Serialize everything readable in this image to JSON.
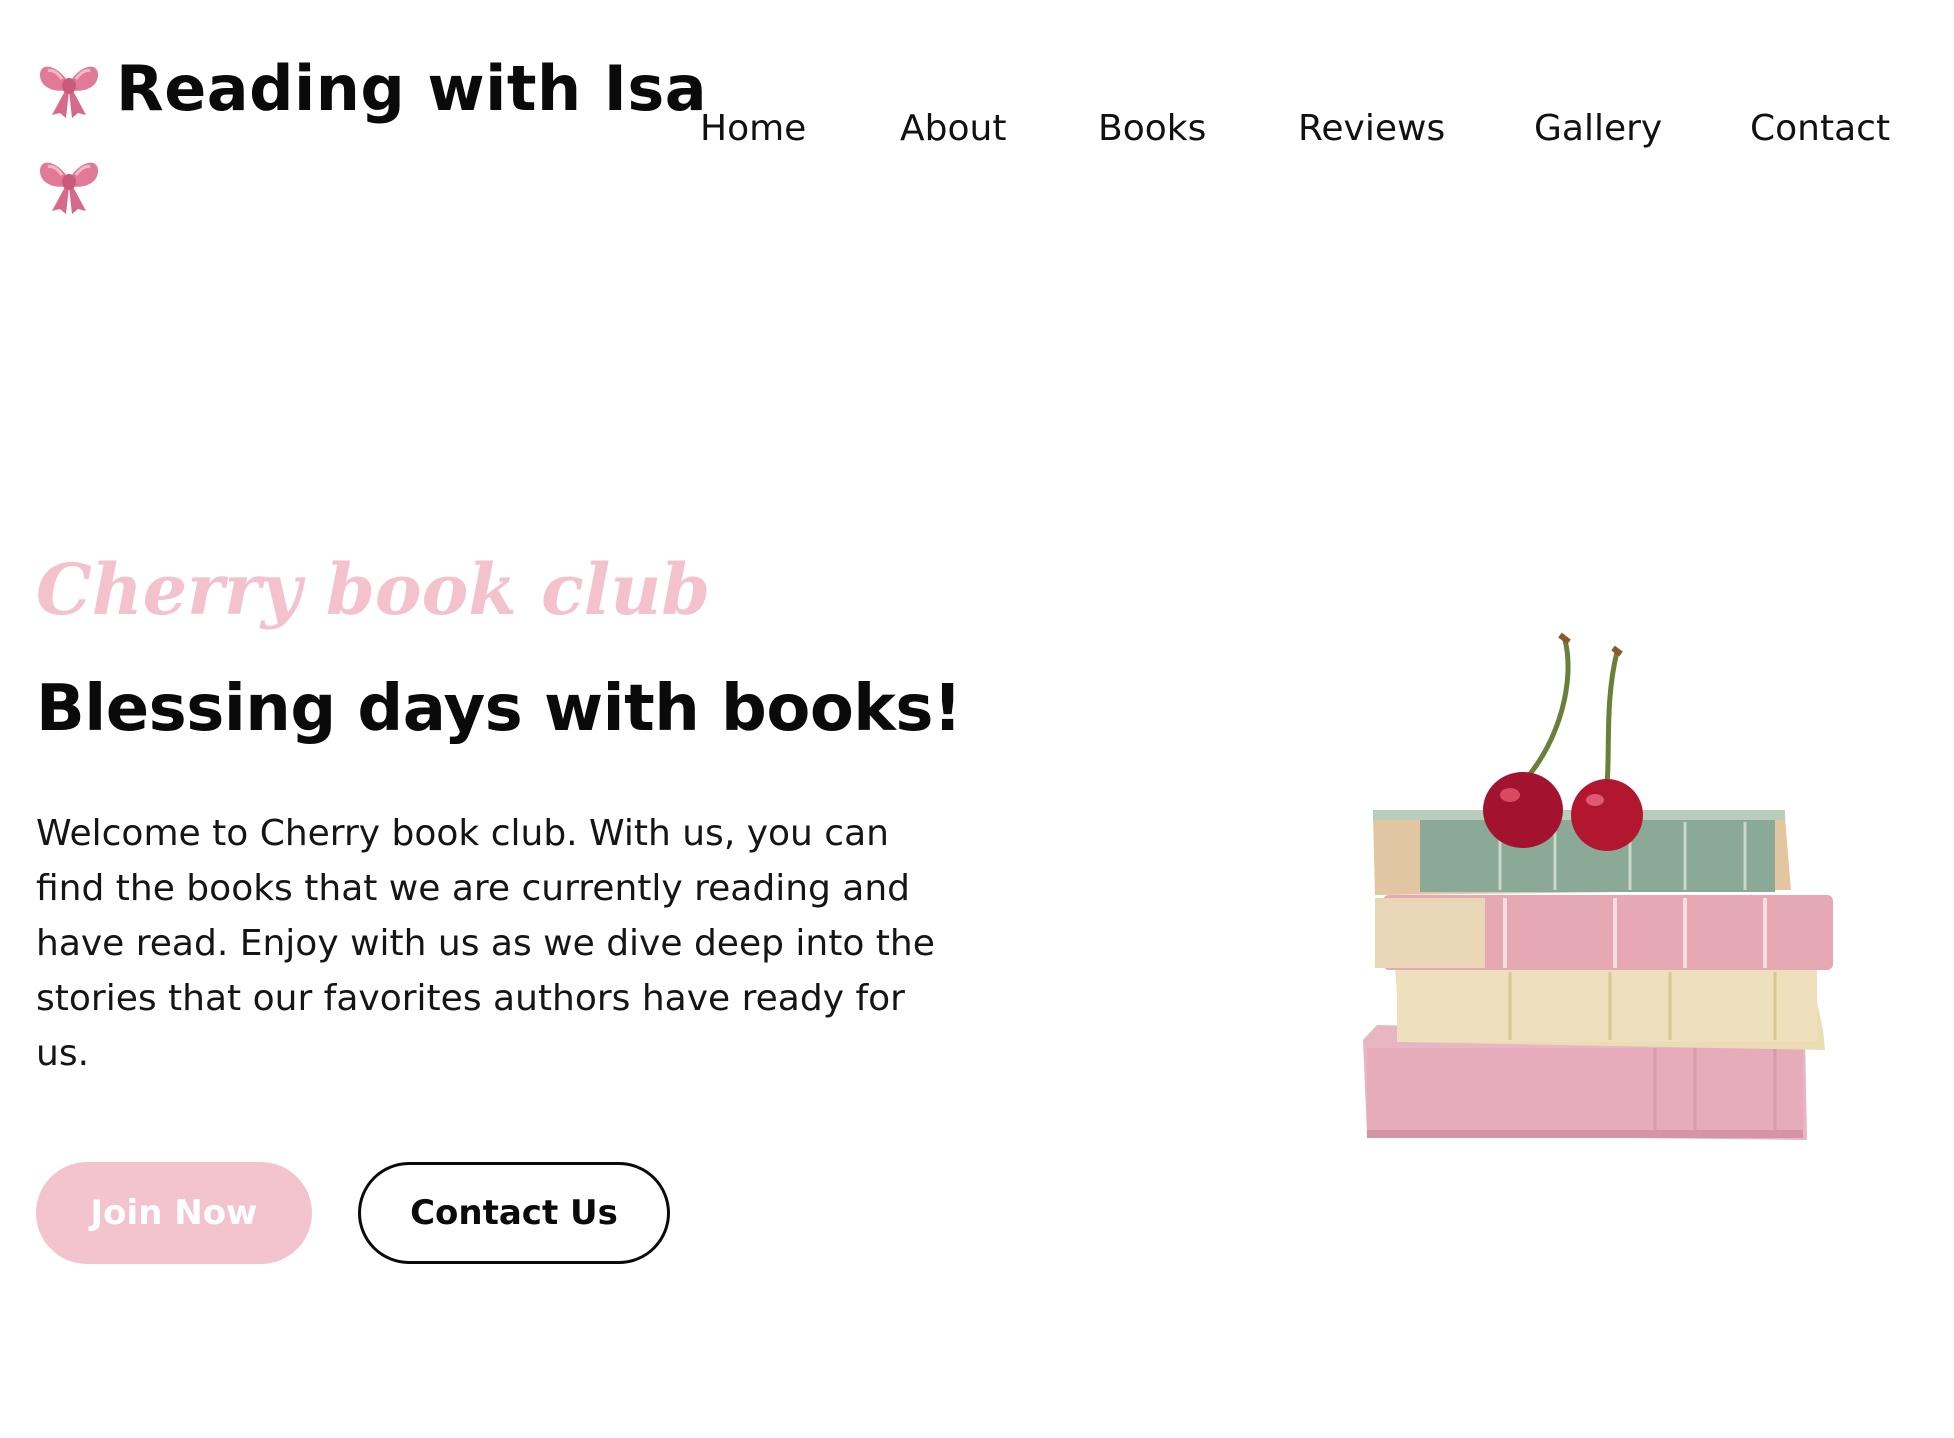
{
  "site": {
    "title": "Reading with Isa",
    "bow_icon": "ribbon-bow-icon",
    "bow_color": "#e07a96"
  },
  "nav": {
    "items": [
      "Home",
      "About",
      "Books",
      "Reviews",
      "Gallery",
      "Contact"
    ]
  },
  "hero": {
    "tagline": "Cherry book club",
    "headline": "Blessing days with books!",
    "intro": "Welcome to Cherry book club. With us, you can find the books that we are currently reading and have read. Enjoy with us as we dive deep into the stories that our favorites authors have ready for us.",
    "join_label": "Join Now",
    "contact_label": "Contact Us",
    "image_icon": "books-with-cherries-image"
  },
  "colors": {
    "accent_pink": "#f4c4ce",
    "text": "#0a0a0a",
    "background": "#ffffff"
  }
}
